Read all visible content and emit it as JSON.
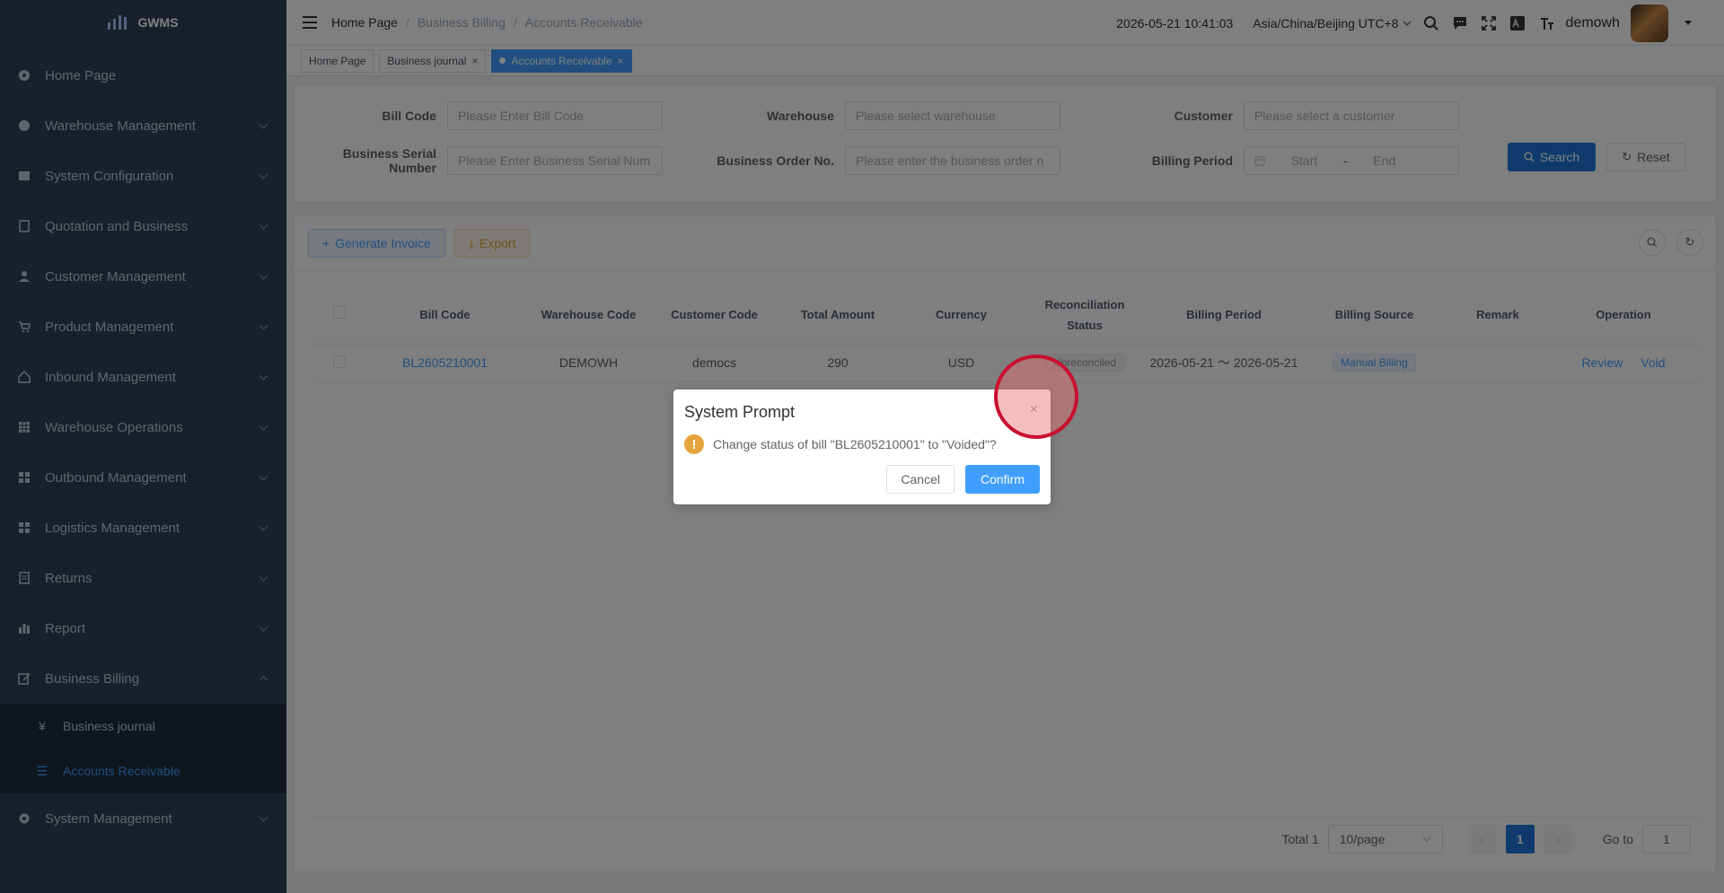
{
  "app": {
    "name": "GWMS"
  },
  "sidebar": {
    "items": [
      {
        "label": "Home Page",
        "icon": "dashboard-icon"
      },
      {
        "label": "Warehouse Management",
        "icon": "globe-icon"
      },
      {
        "label": "System Configuration",
        "icon": "config-icon"
      },
      {
        "label": "Quotation and Business",
        "icon": "quotation-icon"
      },
      {
        "label": "Customer Management",
        "icon": "user-icon"
      },
      {
        "label": "Product Management",
        "icon": "cart-icon"
      },
      {
        "label": "Inbound Management",
        "icon": "home-icon"
      },
      {
        "label": "Warehouse Operations",
        "icon": "grid-icon"
      },
      {
        "label": "Outbound Management",
        "icon": "tiles-icon"
      },
      {
        "label": "Logistics Management",
        "icon": "tiles-icon"
      },
      {
        "label": "Returns",
        "icon": "document-icon"
      },
      {
        "label": "Report",
        "icon": "bar-chart-icon"
      },
      {
        "label": "Business Billing",
        "icon": "edit-icon"
      },
      {
        "label": "System Management",
        "icon": "gear-icon"
      }
    ],
    "submenu": [
      {
        "label": "Business journal",
        "icon": "yen-icon"
      },
      {
        "label": "Accounts Receivable",
        "icon": "list-icon"
      }
    ]
  },
  "header": {
    "breadcrumb": [
      "Home Page",
      "Business Billing",
      "Accounts Receivable"
    ],
    "datetime": "2026-05-21 10:41:03",
    "timezone": "Asia/China/Beijing UTC+8",
    "username": "demowh"
  },
  "tabs": [
    {
      "label": "Home Page"
    },
    {
      "label": "Business journal"
    },
    {
      "label": "Accounts Receivable"
    }
  ],
  "filters": {
    "bill_code": {
      "label": "Bill Code",
      "placeholder": "Please Enter Bill Code"
    },
    "warehouse": {
      "label": "Warehouse",
      "placeholder": "Please select warehouse"
    },
    "customer": {
      "label": "Customer",
      "placeholder": "Please select a customer"
    },
    "serial": {
      "label": "Business Serial Number",
      "placeholder": "Please Enter Business Serial Num"
    },
    "order_no": {
      "label": "Business Order No.",
      "placeholder": "Please enter the business order n"
    },
    "billing_period": {
      "label": "Billing Period",
      "start": "Start",
      "sep": "-",
      "end": "End"
    },
    "search_label": "Search",
    "reset_label": "Reset"
  },
  "toolbar": {
    "generate_label": "Generate Invoice",
    "export_label": "Export"
  },
  "table": {
    "headers": [
      "Bill Code",
      "Warehouse Code",
      "Customer Code",
      "Total Amount",
      "Currency",
      "Reconciliation",
      "Status",
      "Billing Period",
      "Billing Source",
      "Remark",
      "Operation"
    ],
    "rows": [
      {
        "bill_code": "BL2605210001",
        "warehouse_code": "DEMOWH",
        "customer_code": "democs",
        "total_amount": "290",
        "currency": "USD",
        "status": "Unreconciled",
        "billing_period": "2026-05-21 ～ 2026-05-21",
        "billing_source": "Manual Billing",
        "remark": "",
        "review": "Review",
        "void": "Void"
      }
    ]
  },
  "pagination": {
    "total": "Total 1",
    "page_size": "10/page",
    "current": "1",
    "goto_label": "Go to",
    "goto_value": "1",
    "prev": "‹",
    "next": "›"
  },
  "dialog": {
    "title": "System Prompt",
    "close": "×",
    "message": "Change status of bill \"BL2605210001\" to \"Voided\"?",
    "warn": "!",
    "cancel_label": "Cancel",
    "confirm_label": "Confirm"
  }
}
